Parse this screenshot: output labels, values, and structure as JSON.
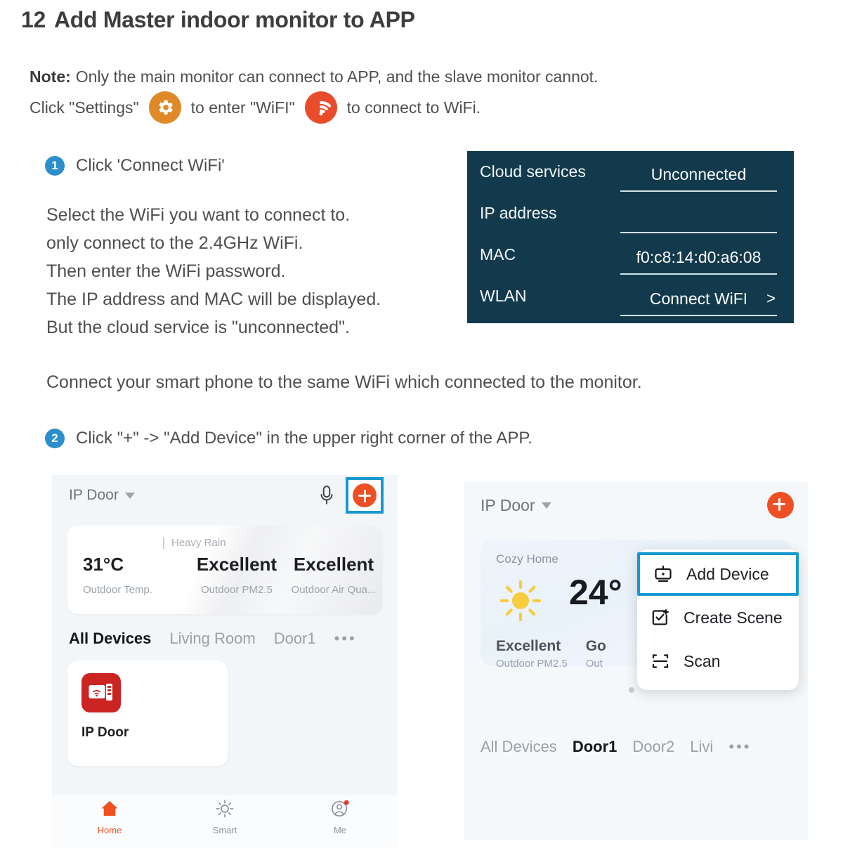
{
  "heading": {
    "number": "12",
    "title": "Add Master indoor monitor to APP"
  },
  "note": {
    "label": "Note:",
    "line1": "Only the main monitor can connect to APP,  and the slave monitor cannot.",
    "line2_part1": "Click \"Settings\"",
    "line2_part2": "to enter \"WiFI\"",
    "line2_part3": "to connect to WiFi.",
    "gear_icon": "gear-icon",
    "wifi_icon": "wifi-icon"
  },
  "steps": {
    "one": {
      "badge": "1",
      "label": "Click 'Connect WiFi'"
    },
    "two": {
      "badge": "2",
      "label": "Click \"+\" -> \"Add Device\" in the upper right corner of the APP."
    }
  },
  "paragraphs": {
    "select_wifi": [
      "Select the WiFi you want to connect to.",
      "only connect to the 2.4GHz WiFi.",
      "Then enter the WiFi password.",
      "The IP address and MAC will be displayed.",
      "But the cloud service is \"unconnected\"."
    ],
    "connect_phone": "Connect your smart phone to the same WiFi which connected to the monitor."
  },
  "settings_panel": {
    "background": "#123a4c",
    "rows": [
      {
        "key": "Cloud services",
        "value": "Unconnected",
        "chevron": ""
      },
      {
        "key": "IP address",
        "value": "",
        "chevron": ""
      },
      {
        "key": "MAC",
        "value": "f0:c8:14:d0:a6:08",
        "chevron": ""
      },
      {
        "key": "WLAN",
        "value": "Connect WiFI",
        "chevron": ">"
      }
    ]
  },
  "phone_left": {
    "home_name": "IP Door",
    "mic_icon": "microphone-icon",
    "plus_icon": "plus-icon",
    "weather": {
      "condition": "Heavy Rain",
      "cells": [
        {
          "big": "31°C",
          "sub": "Outdoor Temp."
        },
        {
          "big": "Excellent",
          "sub": "Outdoor PM2.5"
        },
        {
          "big": "Excellent",
          "sub": "Outdoor Air Qua..."
        }
      ]
    },
    "tabs": [
      "All Devices",
      "Living Room",
      "Door1"
    ],
    "tabs_active": "All Devices",
    "tabs_more": "•••",
    "device": {
      "name": "IP Door",
      "icon": "ip-door-monitor-icon"
    },
    "bottom_nav": [
      {
        "label": "Home",
        "icon": "home-icon",
        "active": true
      },
      {
        "label": "Smart",
        "icon": "sun-icon",
        "active": false
      },
      {
        "label": "Me",
        "icon": "profile-icon",
        "active": false
      }
    ]
  },
  "phone_right": {
    "home_name": "IP Door",
    "plus_icon": "plus-icon",
    "weather": {
      "scene_name": "Cozy Home",
      "temperature": "24°",
      "sun_icon": "sun-icon",
      "cells": [
        {
          "big": "Excellent",
          "sub": "Outdoor PM2.5"
        },
        {
          "big": "Go",
          "sub": "Out"
        }
      ]
    },
    "menu": [
      {
        "label": "Add Device",
        "icon": "add-device-icon",
        "highlighted": true
      },
      {
        "label": "Create Scene",
        "icon": "create-scene-icon",
        "highlighted": false
      },
      {
        "label": "Scan",
        "icon": "scan-icon",
        "highlighted": false
      }
    ],
    "tabs": [
      "All Devices",
      "Door1",
      "Door2",
      "Livi"
    ],
    "tabs_active": "Door1",
    "tabs_more": "•••"
  },
  "colors": {
    "accent_orange": "#EE5024",
    "gear_gold": "#DF8A26",
    "wifi_red": "#E84C2B",
    "step_blue": "#2C8FCD",
    "highlight_blue": "#1699CF",
    "panel_dark": "#123a4c",
    "device_red": "#CC2423"
  }
}
